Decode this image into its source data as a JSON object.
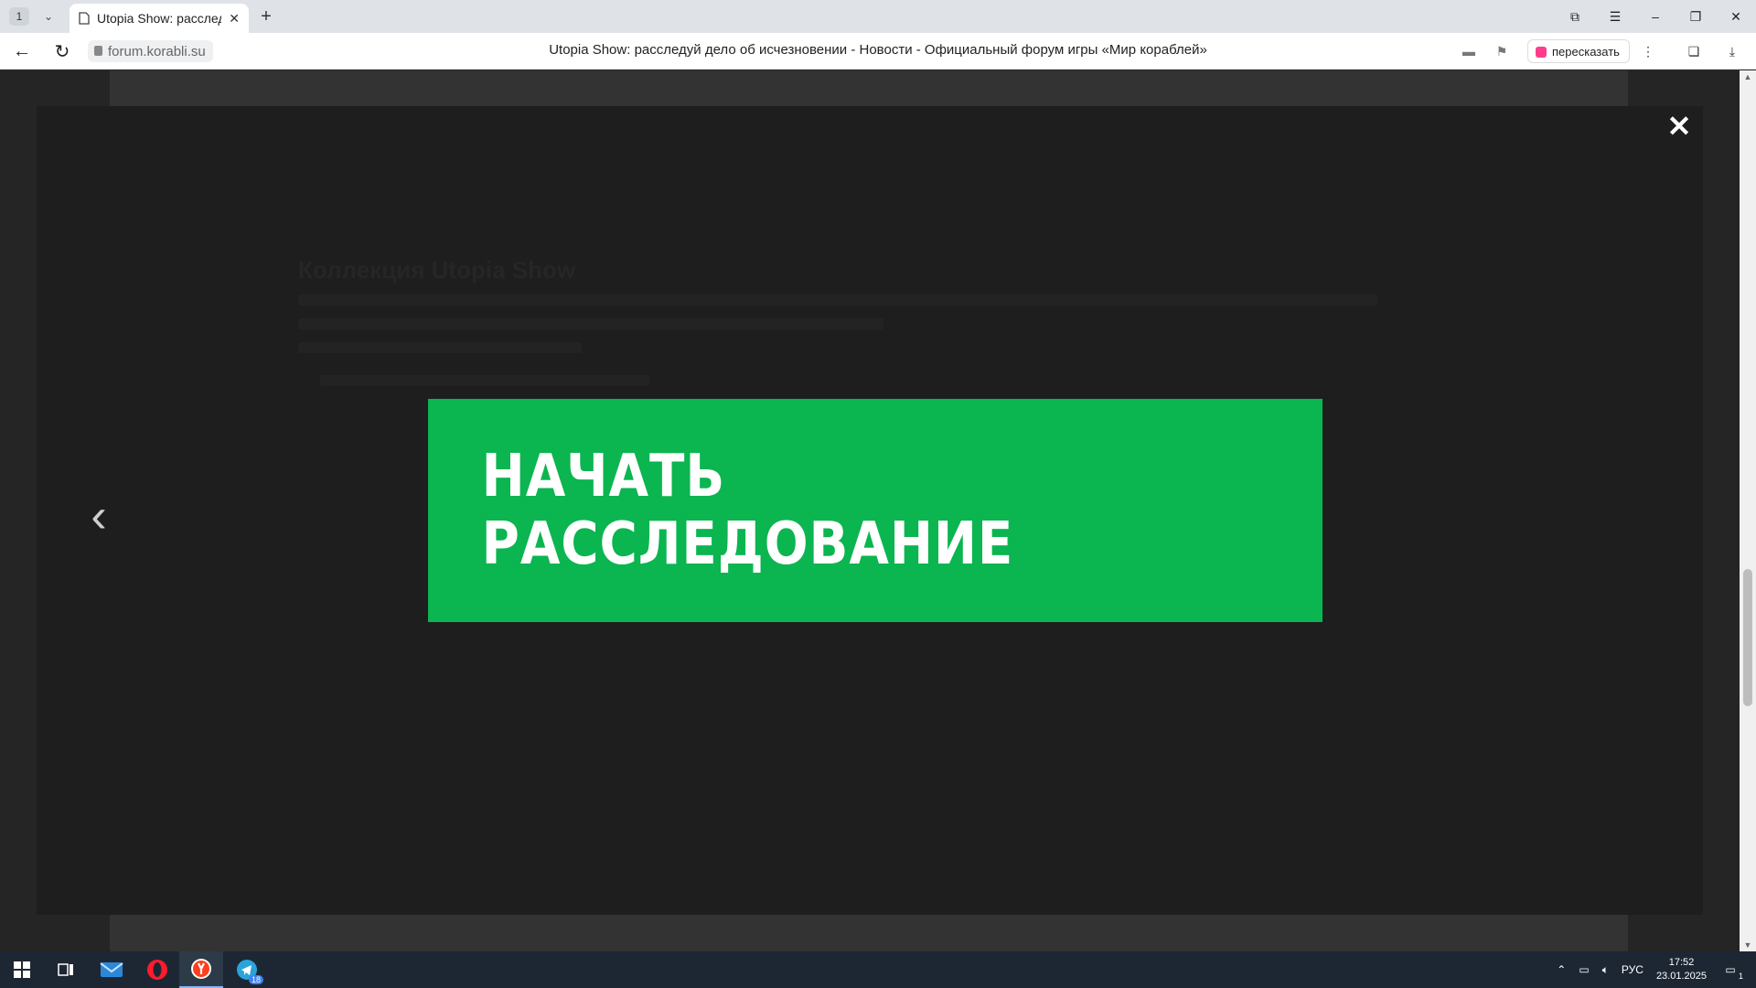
{
  "browser": {
    "tab_count": "1",
    "tab_title": "Utopia Show: расследу",
    "url": "forum.korabli.su",
    "page_title": "Utopia Show: расследуй дело об исчезновении - Новости - Официальный форум игры «Мир кораблей»",
    "retell_label": "пересказать"
  },
  "background": {
    "heading": "Коллекция Utopia Show"
  },
  "lightbox": {
    "cta_label": "НАЧАТЬ РАССЛЕДОВАНИЕ",
    "close_glyph": "✕",
    "prev_glyph": "‹"
  },
  "colors": {
    "cta": "#0bb550",
    "overlay": "#1e1e1e",
    "taskbar": "#1d2733"
  },
  "taskbar": {
    "lang": "РУС",
    "time": "17:52",
    "date": "23.01.2025",
    "telegram_badge": "18",
    "notif_badge": "1",
    "apps": [
      "start-icon",
      "task-view-icon",
      "mail-icon",
      "opera-icon",
      "yandex-browser-icon",
      "telegram-icon"
    ]
  }
}
